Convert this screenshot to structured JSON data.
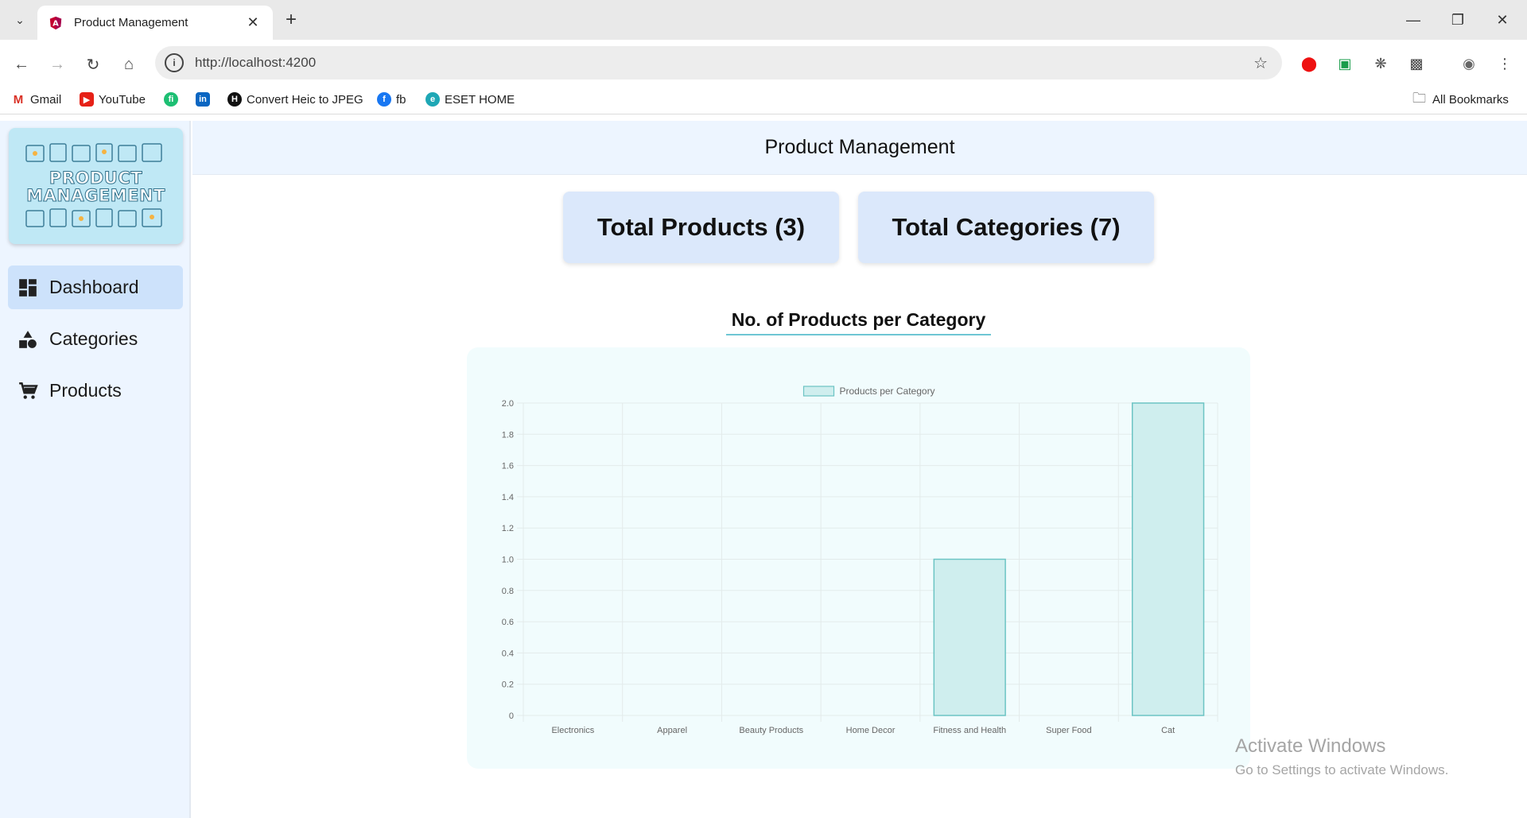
{
  "browser": {
    "tab_title": "Product Management",
    "url": "http://localhost:4200",
    "bookmarks": [
      {
        "label": "Gmail",
        "icon": "gmail-icon"
      },
      {
        "label": "YouTube",
        "icon": "youtube-icon"
      },
      {
        "label": "",
        "icon": "fiverr-icon"
      },
      {
        "label": "",
        "icon": "linkedin-icon"
      },
      {
        "label": "Convert Heic to JPEG",
        "icon": "heic-icon"
      },
      {
        "label": "fb",
        "icon": "facebook-icon"
      },
      {
        "label": "ESET HOME",
        "icon": "eset-icon"
      }
    ],
    "all_bookmarks_label": "All Bookmarks"
  },
  "sidebar": {
    "logo_text_line1": "PRODUCT",
    "logo_text_line2": "MANAGEMENT",
    "items": [
      {
        "label": "Dashboard",
        "icon": "dashboard-icon",
        "active": true
      },
      {
        "label": "Categories",
        "icon": "categories-icon",
        "active": false
      },
      {
        "label": "Products",
        "icon": "cart-icon",
        "active": false
      }
    ]
  },
  "header": {
    "title": "Product Management"
  },
  "cards": {
    "total_products": "Total Products (3)",
    "total_categories": "Total Categories (7)"
  },
  "chart_section": {
    "title": "No. of Products per Category"
  },
  "chart_data": {
    "type": "bar",
    "categories": [
      "Electronics",
      "Apparel",
      "Beauty Products",
      "Home Decor",
      "Fitness and Health",
      "Super Food",
      "Cat"
    ],
    "series": [
      {
        "name": "Products per Category",
        "values": [
          0,
          0,
          0,
          0,
          1,
          0,
          2
        ]
      }
    ],
    "ylim": [
      0,
      2.0
    ],
    "yticks": [
      "0",
      "0.2",
      "0.4",
      "0.6",
      "0.8",
      "1.0",
      "1.2",
      "1.4",
      "1.6",
      "1.8",
      "2.0"
    ],
    "legend": "top-center",
    "grid": true,
    "colors": {
      "fill": "#cfeeee",
      "stroke": "#6cc4c4",
      "grid": "#e3ebeb",
      "tick_text": "#666666"
    }
  },
  "watermark": {
    "line1": "Activate Windows",
    "line2": "Go to Settings to activate Windows."
  }
}
